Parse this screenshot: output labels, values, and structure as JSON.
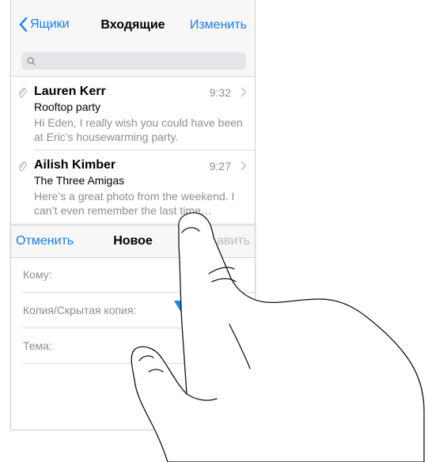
{
  "inbox": {
    "back_label": "Ящики",
    "title": "Входящие",
    "edit_label": "Изменить",
    "search_placeholder": "",
    "messages": [
      {
        "sender": "Lauren Kerr",
        "time": "9:32",
        "subject": "Rooftop party",
        "preview": "Hi Eden, I really wish you could have been at Eric’s housewarming party."
      },
      {
        "sender": "Ailish Kimber",
        "time": "9:27",
        "subject": "The Three Amigas",
        "preview": "Here’s a great photo from the weekend. I can’t even remember the last time…"
      }
    ]
  },
  "compose": {
    "cancel_label": "Отменить",
    "title": "Новое",
    "send_label": "авить",
    "to_label": "Кому:",
    "cc_bcc_label": "Копия/Скрытая копия:",
    "subject_label": "Тема:"
  },
  "colors": {
    "accent": "#1a7cf5",
    "arrow": "#1e88e5",
    "secondary_text": "#8e8e93",
    "bar_background": "#f7f7f8"
  },
  "icons": {
    "back": "chevron-left-icon",
    "search": "search-icon",
    "attachment": "paperclip-icon",
    "disclosure": "chevron-right-icon",
    "gesture": "swipe-down-arrow-icon",
    "hand": "hand-illustration"
  }
}
